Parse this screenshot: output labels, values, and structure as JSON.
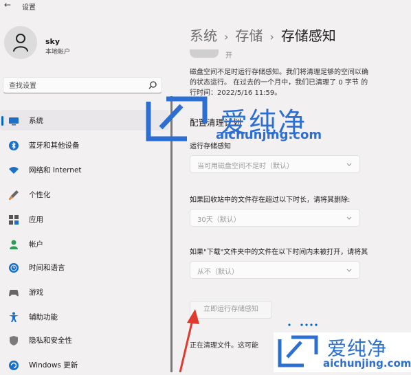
{
  "window": {
    "title": "设置",
    "back_icon": "back-arrow-icon"
  },
  "user": {
    "name": "sky",
    "account_type": "本地帐户"
  },
  "search": {
    "placeholder": "查找设置"
  },
  "sidebar": {
    "items": [
      {
        "label": "系统",
        "icon": "monitor-icon",
        "selected": true
      },
      {
        "label": "蓝牙和其他设备",
        "icon": "bluetooth-icon"
      },
      {
        "label": "网络和 Internet",
        "icon": "wifi-icon"
      },
      {
        "label": "个性化",
        "icon": "brush-icon"
      },
      {
        "label": "应用",
        "icon": "apps-icon"
      },
      {
        "label": "帐户",
        "icon": "account-icon"
      },
      {
        "label": "时间和语言",
        "icon": "globe-icon"
      },
      {
        "label": "游戏",
        "icon": "gamepad-icon"
      },
      {
        "label": "辅助功能",
        "icon": "accessibility-icon"
      },
      {
        "label": "隐私和安全性",
        "icon": "shield-icon"
      },
      {
        "label": "Windows 更新",
        "icon": "update-icon"
      }
    ]
  },
  "breadcrumb": {
    "part1": "系统",
    "part2": "存储",
    "current": "存储感知",
    "separator": "›"
  },
  "toggle": {
    "label": "开"
  },
  "description": {
    "line1": "磁盘空间不足时运行存储感知。我们将清理足够的空间以确",
    "line2": "的状态运行。 在过去的一个月中，我们已清理了 0 字节 的",
    "line3": "行时间：2022/5/16 11:59。"
  },
  "section": {
    "title": "配置清理计划"
  },
  "fields": {
    "run_label": "运行存储感知",
    "run_value": "当可用磁盘空间不足时（默认）",
    "recycle_label": "如果回收站中的文件存在超过以下时长，请将其删除:",
    "recycle_value": "30天（默认）",
    "downloads_label": "如果\"下载\"文件夹中的文件在以下时间内未被打开，请将其",
    "downloads_value": "从不（默认）"
  },
  "actions": {
    "run_now": "立即运行存储感知"
  },
  "status": {
    "text": "正在清理文件。这可能"
  },
  "watermark": {
    "brand": "爱纯净",
    "url": "aichunjing.com"
  },
  "colors": {
    "accent": "#0067c0",
    "watermark": "#2c6fd1",
    "arrow": "#e03a2f"
  }
}
